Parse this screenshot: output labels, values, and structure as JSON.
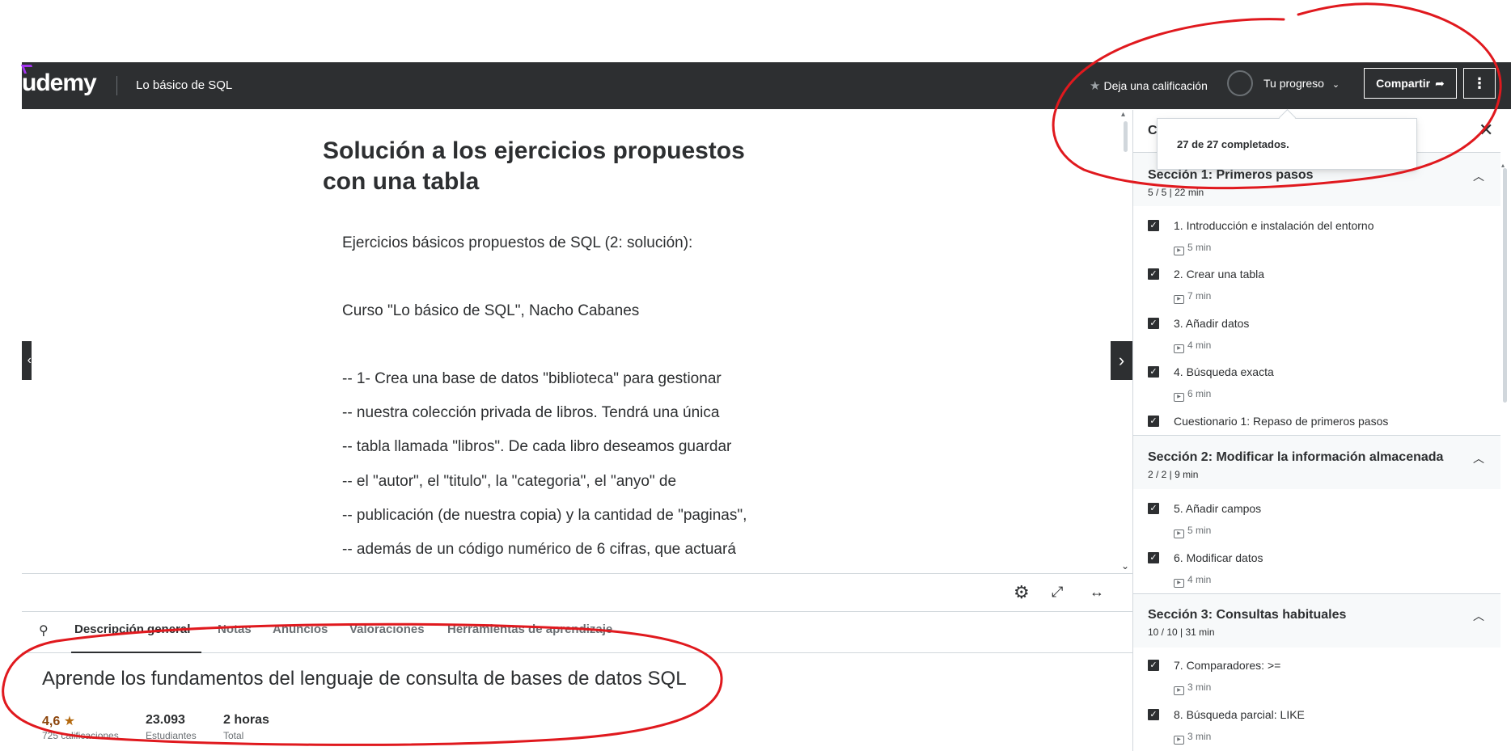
{
  "header": {
    "logo": "udemy",
    "course_title": "Lo básico de SQL",
    "rate_label": "Deja una calificación",
    "progress_label": "Tu progreso",
    "share_label": "Compartir",
    "more_label": "⋮"
  },
  "lecture": {
    "title_line1": "Solución a los ejercicios propuestos",
    "title_line2": "con una tabla",
    "lines": [
      "Ejercicios básicos propuestos de SQL (2: solución):",
      "Curso \"Lo básico de SQL\", Nacho Cabanes",
      "-- 1- Crea una base de datos \"biblioteca\" para gestionar",
      "-- nuestra colección privada de libros. Tendrá una única",
      "-- tabla llamada \"libros\". De cada libro deseamos guardar",
      "-- el \"autor\", el \"titulo\", la \"categoria\", el \"anyo\" de",
      "-- publicación (de nuestra copia) y la cantidad de \"paginas\",",
      "-- además de un código numérico de 6 cifras, que actuará"
    ]
  },
  "tabs": {
    "items": [
      "Descripción general",
      "Notas",
      "Anuncios",
      "Valoraciones",
      "Herramientas de aprendizaje"
    ]
  },
  "overview": {
    "heading": "Aprende los fundamentos del lenguaje de consulta de bases de datos SQL",
    "rating": "4,6",
    "rating_label": "725 calificaciones",
    "students": "23.093",
    "students_label": "Estudiantes",
    "duration": "2 horas",
    "duration_label": "Total"
  },
  "popover": {
    "text": "27 de 27 completados."
  },
  "sidebar": {
    "heading": "C",
    "sections": [
      {
        "title": "Sección 1: Primeros pasos",
        "meta": "5 / 5 | 22 min",
        "items": [
          {
            "title": "1. Introducción e instalación del entorno",
            "duration": "5 min"
          },
          {
            "title": "2. Crear una tabla",
            "duration": "7 min"
          },
          {
            "title": "3. Añadir datos",
            "duration": "4 min"
          },
          {
            "title": "4. Búsqueda exacta",
            "duration": "6 min"
          },
          {
            "title": "Cuestionario 1: Repaso de primeros pasos",
            "duration": ""
          }
        ]
      },
      {
        "title": "Sección 2: Modificar la información almacenada",
        "meta": "2 / 2 | 9 min",
        "items": [
          {
            "title": "5. Añadir campos",
            "duration": "5 min"
          },
          {
            "title": "6. Modificar datos",
            "duration": "4 min"
          }
        ]
      },
      {
        "title": "Sección 3: Consultas habituales",
        "meta": "10 / 10 | 31 min",
        "items": [
          {
            "title": "7. Comparadores: >=",
            "duration": "3 min"
          },
          {
            "title": "8. Búsqueda parcial: LIKE",
            "duration": "3 min"
          }
        ]
      }
    ]
  },
  "colors": {
    "header_bg": "#2d2f31",
    "brand_purple": "#a435f0",
    "star": "#b4690e",
    "annotation": "#e0191e"
  }
}
